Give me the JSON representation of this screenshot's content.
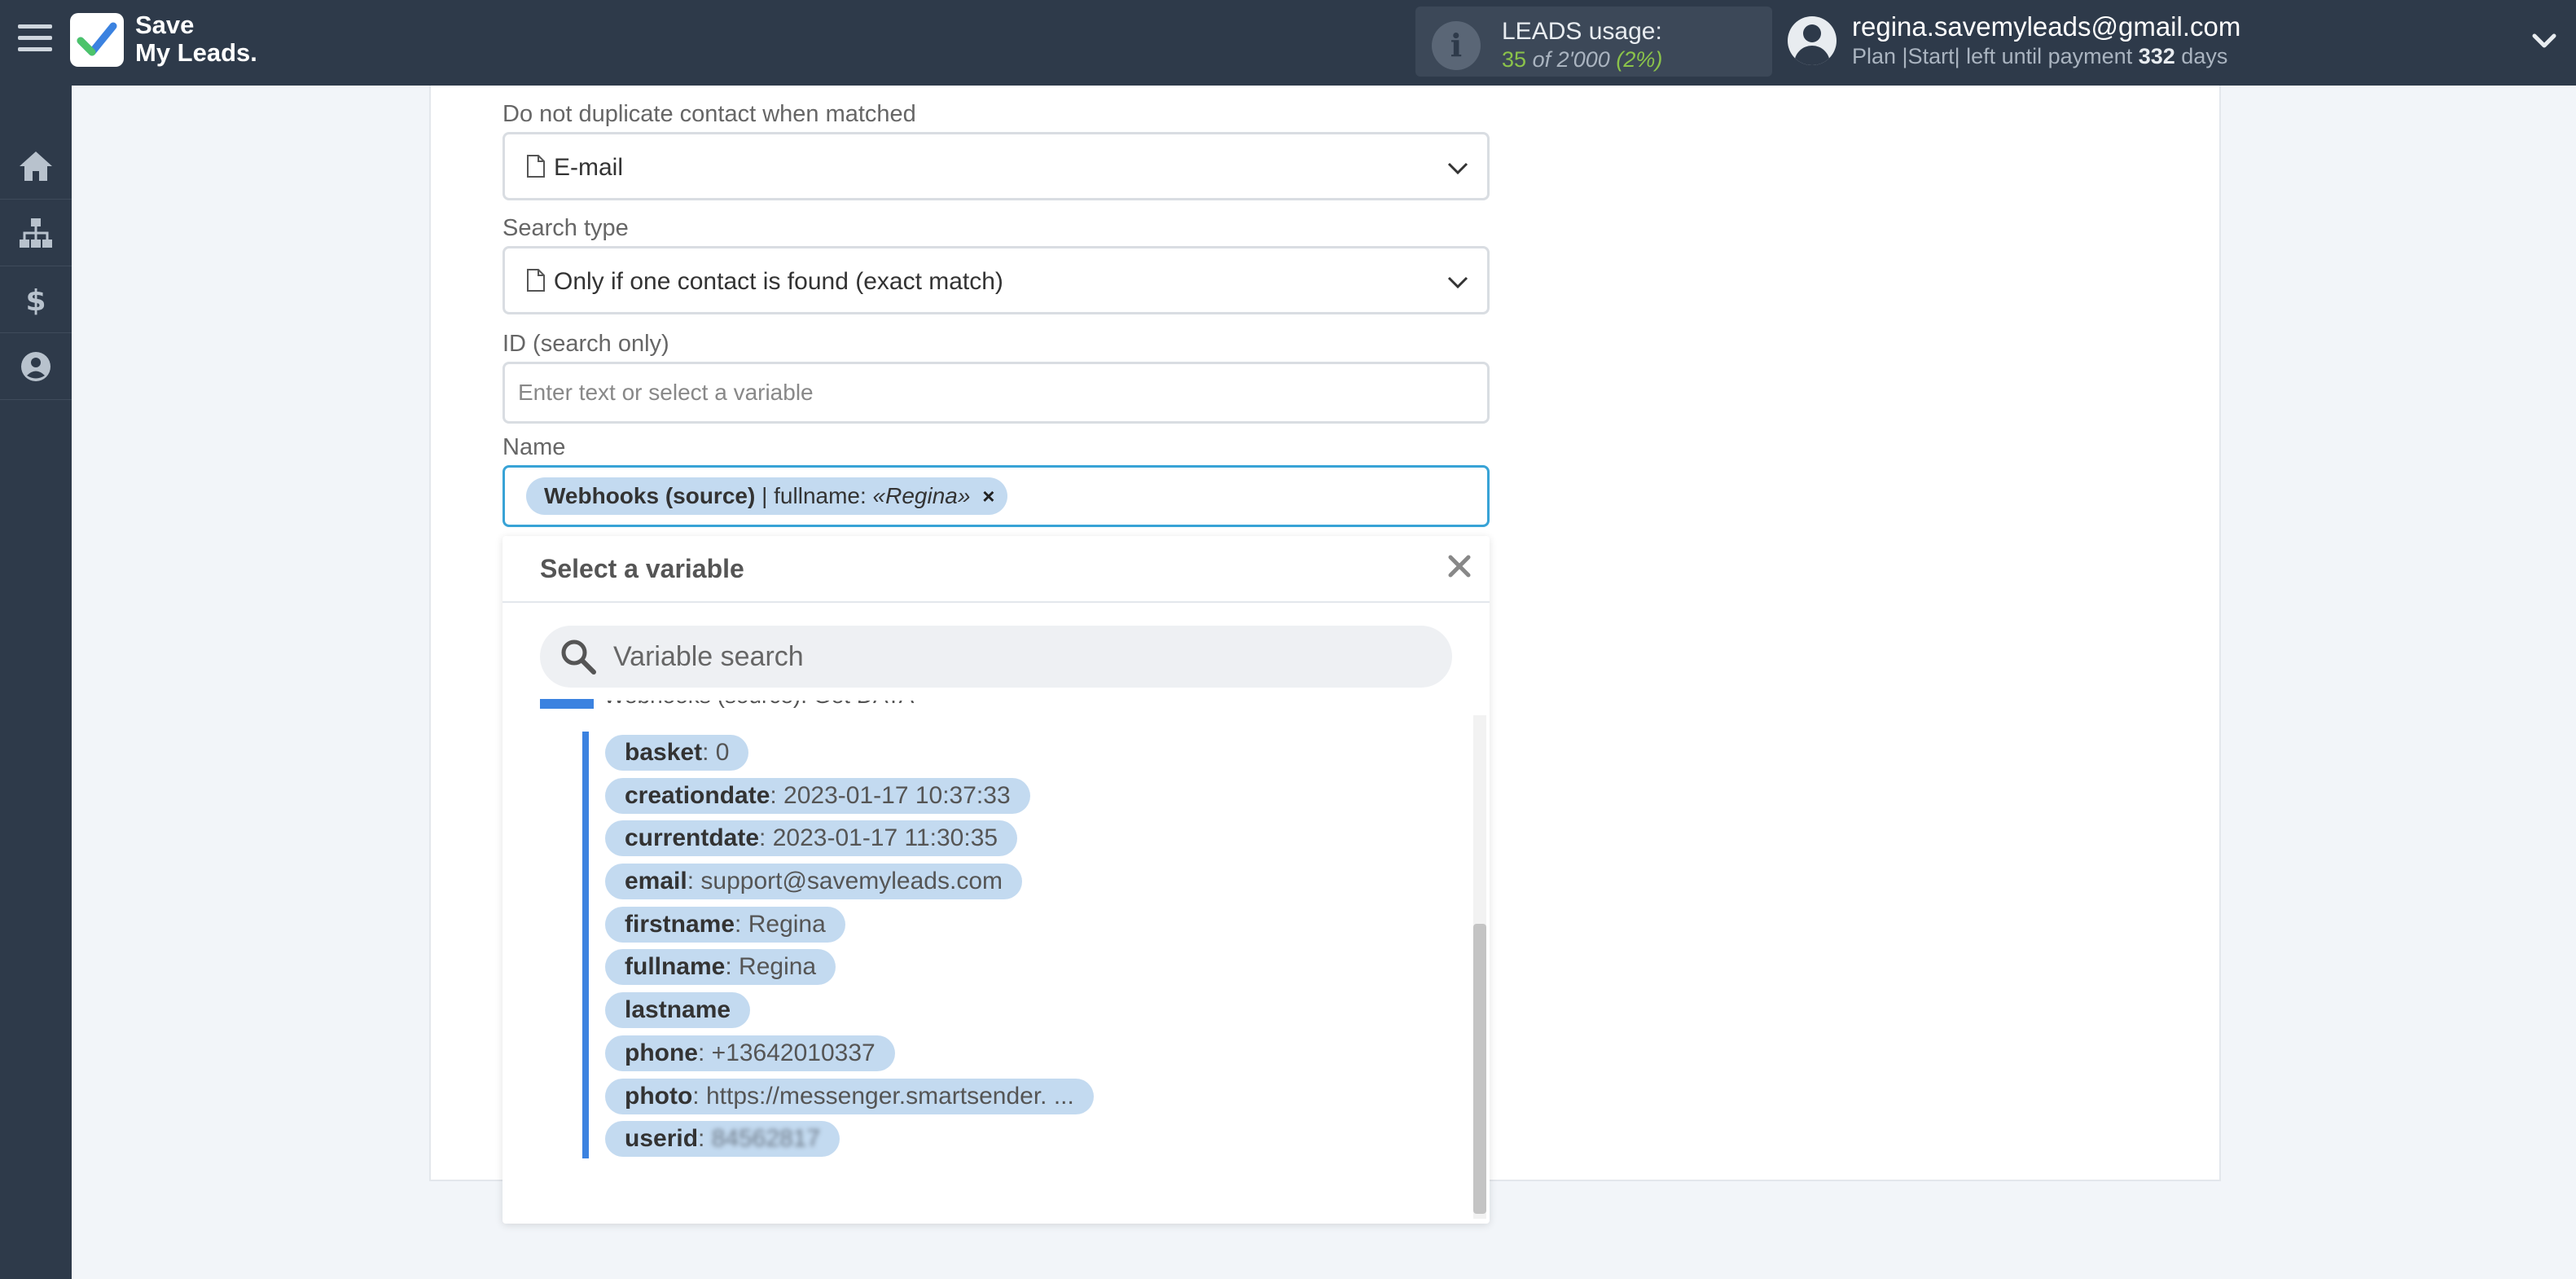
{
  "brand": {
    "line1": "Save",
    "line2": "My Leads."
  },
  "leads": {
    "label": "LEADS usage:",
    "used": "35",
    "of_text": "of 2'000",
    "pct": "(2%)"
  },
  "user": {
    "email": "regina.savemyleads@gmail.com",
    "plan_prefix": "Plan |Start| left until payment",
    "days": "332",
    "days_suffix": "days"
  },
  "sidebar": {
    "items": [
      "home-icon",
      "sitemap-icon",
      "dollar-icon",
      "user-circle-icon"
    ]
  },
  "form": {
    "no_dup_label": "Do not duplicate contact when matched",
    "no_dup_value": "E-mail",
    "search_type_label": "Search type",
    "search_type_value": "Only if one contact is found (exact match)",
    "id_label": "ID (search only)",
    "id_placeholder": "Enter text or select a variable",
    "name_label": "Name",
    "name_chip": {
      "source": "Webhooks (source)",
      "sep": " | fullname: ",
      "value": "«Regina»",
      "remove": "×"
    }
  },
  "panel": {
    "title": "Select a variable",
    "search_placeholder": "Variable search",
    "group_title": "Webhooks (source): Get DATA",
    "variables": [
      {
        "name": "basket",
        "value": ": 0"
      },
      {
        "name": "creationdate",
        "value": ": 2023-01-17 10:37:33"
      },
      {
        "name": "currentdate",
        "value": ": 2023-01-17 11:30:35"
      },
      {
        "name": "email",
        "value": ": support@savemyleads.com"
      },
      {
        "name": "firstname",
        "value": ": Regina"
      },
      {
        "name": "fullname",
        "value": ": Regina"
      },
      {
        "name": "lastname",
        "value": ""
      },
      {
        "name": "phone",
        "value": ": +13642010337"
      },
      {
        "name": "photo",
        "value": ": https://messenger.smartsender. ..."
      },
      {
        "name": "userid",
        "value": ": ",
        "blurred_value": "84562817"
      }
    ]
  },
  "colors": {
    "topbar": "#2e3a4a",
    "accent_blue": "#3b82e0",
    "chip_bg": "#c3daf0",
    "usage_green": "#8bc34a",
    "focus_border": "#38a3d6"
  }
}
